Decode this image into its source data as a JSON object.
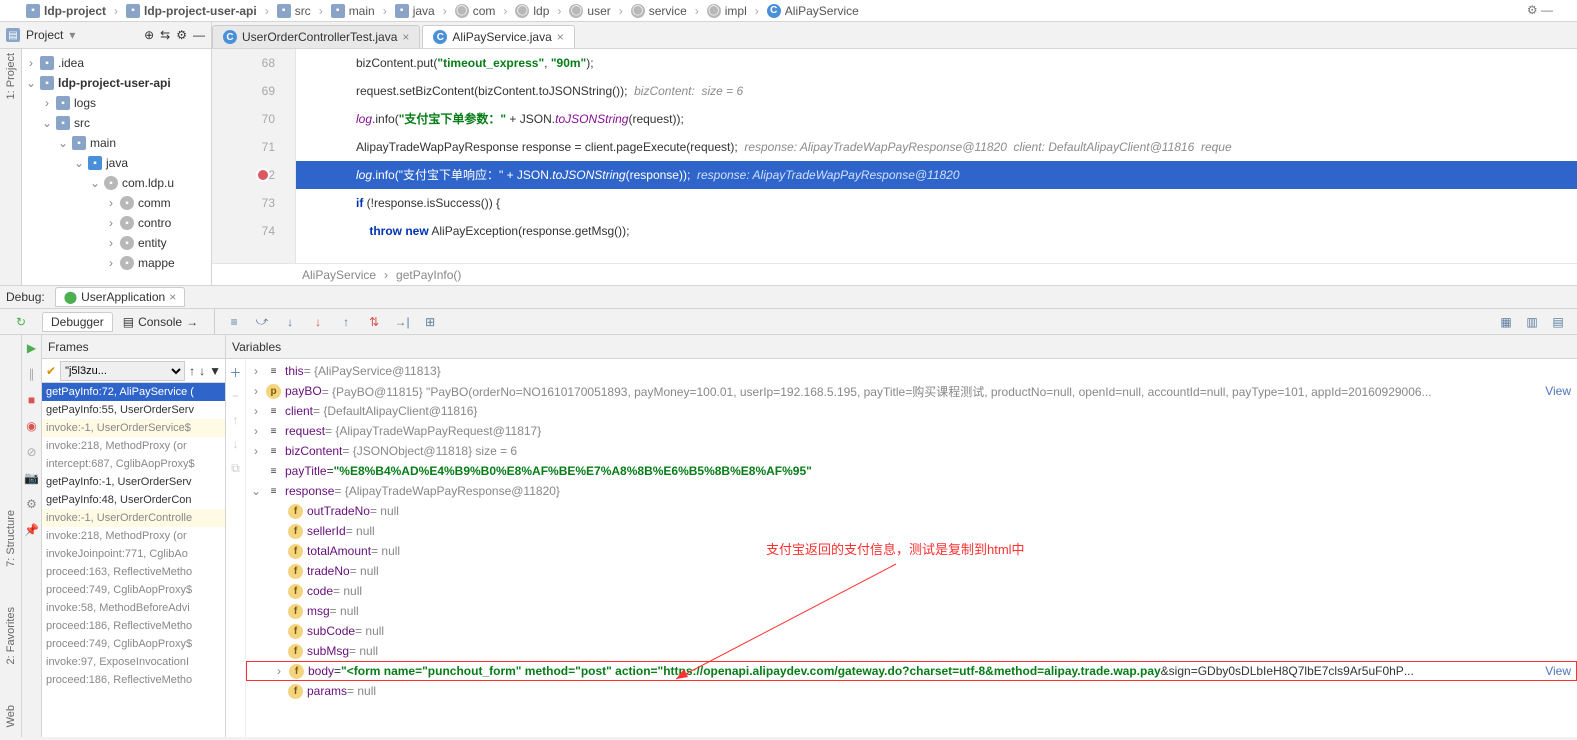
{
  "breadcrumb": [
    "ldp-project",
    "ldp-project-user-api",
    "src",
    "main",
    "java",
    "com",
    "ldp",
    "user",
    "service",
    "impl",
    "AliPayService"
  ],
  "breadcrumb_icons": [
    "folder",
    "folder",
    "folder",
    "folder",
    "folder",
    "package",
    "package",
    "package",
    "package",
    "package",
    "class"
  ],
  "proj_label": "Project",
  "tabs": [
    {
      "label": "UserOrderControllerTest.java",
      "active": false
    },
    {
      "label": "AliPayService.java",
      "active": true
    }
  ],
  "sidetabs": {
    "project": "1: Project",
    "structure": "7: Structure",
    "favorites": "2: Favorites",
    "web": "Web"
  },
  "tree": [
    {
      "ind": 0,
      "tw": "›",
      "ic": "folder",
      "label": ".idea"
    },
    {
      "ind": 0,
      "tw": "⌄",
      "ic": "folder",
      "label": "ldp-project-user-api",
      "bold": true
    },
    {
      "ind": 1,
      "tw": "›",
      "ic": "folder",
      "label": "logs"
    },
    {
      "ind": 1,
      "tw": "⌄",
      "ic": "folder",
      "label": "src"
    },
    {
      "ind": 2,
      "tw": "⌄",
      "ic": "folder",
      "label": "main"
    },
    {
      "ind": 3,
      "tw": "⌄",
      "ic": "folder",
      "label": "java",
      "blue": true
    },
    {
      "ind": 4,
      "tw": "⌄",
      "ic": "package",
      "label": "com.ldp.u"
    },
    {
      "ind": 5,
      "tw": "›",
      "ic": "package",
      "label": "comm"
    },
    {
      "ind": 5,
      "tw": "›",
      "ic": "package",
      "label": "contro"
    },
    {
      "ind": 5,
      "tw": "›",
      "ic": "package",
      "label": "entity"
    },
    {
      "ind": 5,
      "tw": "›",
      "ic": "package",
      "label": "mappe"
    }
  ],
  "code": [
    {
      "n": "68",
      "html": "bizContent.put(<span class='str'>\"timeout_express\"</span>, <span class='str'>\"90m\"</span>);"
    },
    {
      "n": "69",
      "html": "request.setBizContent(bizContent.toJSONString());  <span class='cmt'>bizContent:  size = 6</span>"
    },
    {
      "n": "70",
      "html": "<span class='stat'>log</span>.info(<span class='str'>\"支付宝下单参数：\"</span> + JSON.<span class='stat'>toJSONString</span>(request));"
    },
    {
      "n": "71",
      "html": "AlipayTradeWapPayResponse response = client.pageExecute(request);  <span class='cmt'>response: AlipayTradeWapPayResponse@11820  client: DefaultAlipayClient@11816  reque</span>"
    },
    {
      "n": "72",
      "hl": true,
      "bp": true,
      "html": "<span style='font-style:italic'>log</span>.info(<span>\"支付宝下单响应：\"</span> + JSON.<span style='font-style:italic'>toJSONString</span>(response));  <span style='font-style:italic;color:#cfe0ff'>response: AlipayTradeWapPayResponse@11820</span>"
    },
    {
      "n": "73",
      "html": "<span class='kw'>if</span> (!response.isSuccess()) {"
    },
    {
      "n": "74",
      "html": "    <span class='kw'>throw new</span> AliPayException(response.getMsg());"
    },
    {
      "n": "",
      "html": ""
    }
  ],
  "ed_crumb": [
    "AliPayService",
    "getPayInfo()"
  ],
  "debug_label": "Debug:",
  "debug_tab": "UserApplication",
  "debugger_tab": "Debugger",
  "console_tab": "Console",
  "frames_label": "Frames",
  "thread": "\"j5l3zu...",
  "frames": [
    {
      "t": "getPayInfo:72, AliPayService (",
      "sel": true
    },
    {
      "t": "getPayInfo:55, UserOrderServ"
    },
    {
      "t": "invoke:-1, UserOrderService$",
      "yel": true
    },
    {
      "t": "invoke:218, MethodProxy (or",
      "dim": true
    },
    {
      "t": "intercept:687, CglibAopProxy$",
      "dim": true
    },
    {
      "t": "getPayInfo:-1, UserOrderServ"
    },
    {
      "t": "getPayInfo:48, UserOrderCon"
    },
    {
      "t": "invoke:-1, UserOrderControlle",
      "yel": true
    },
    {
      "t": "invoke:218, MethodProxy (or",
      "dim": true
    },
    {
      "t": "invokeJoinpoint:771, CglibAo",
      "dim": true
    },
    {
      "t": "proceed:163, ReflectiveMetho",
      "dim": true
    },
    {
      "t": "proceed:749, CglibAopProxy$",
      "dim": true
    },
    {
      "t": "invoke:58, MethodBeforeAdvi",
      "dim": true
    },
    {
      "t": "proceed:186, ReflectiveMetho",
      "dim": true
    },
    {
      "t": "proceed:749, CglibAopProxy$",
      "dim": true
    },
    {
      "t": "invoke:97, ExposeInvocationI",
      "dim": true
    },
    {
      "t": "proceed:186, ReflectiveMetho",
      "dim": true
    }
  ],
  "variables_label": "Variables",
  "vars": [
    {
      "ind": 0,
      "tw": "›",
      "b": "eq",
      "name": "this",
      "val": " = {AliPayService@11813}"
    },
    {
      "ind": 0,
      "tw": "›",
      "b": "p",
      "name": "payBO",
      "val": " = {PayBO@11815} \"PayBO(orderNo=NO1610170051893, payMoney=100.01, userIp=192.168.5.195, payTitle=购买课程测试, productNo=null, openId=null, accountId=null, payType=101, appId=20160929006...",
      "view": true
    },
    {
      "ind": 0,
      "tw": "›",
      "b": "eq",
      "name": "client",
      "val": " = {DefaultAlipayClient@11816}"
    },
    {
      "ind": 0,
      "tw": "›",
      "b": "eq",
      "name": "request",
      "val": " = {AlipayTradeWapPayRequest@11817}"
    },
    {
      "ind": 0,
      "tw": "›",
      "b": "eq",
      "name": "bizContent",
      "val": " = {JSONObject@11818}  size = 6"
    },
    {
      "ind": 0,
      "tw": "",
      "b": "eq",
      "name": "payTitle",
      "str": "\"%E8%B4%AD%E4%B9%B0%E8%AF%BE%E7%A8%8B%E6%B5%8B%E8%AF%95\""
    },
    {
      "ind": 0,
      "tw": "⌄",
      "b": "eq",
      "name": "response",
      "val": " = {AlipayTradeWapPayResponse@11820}"
    },
    {
      "ind": 1,
      "tw": "",
      "b": "f",
      "name": "outTradeNo",
      "val": " = null"
    },
    {
      "ind": 1,
      "tw": "",
      "b": "f",
      "name": "sellerId",
      "val": " = null"
    },
    {
      "ind": 1,
      "tw": "",
      "b": "f",
      "name": "totalAmount",
      "val": " = null"
    },
    {
      "ind": 1,
      "tw": "",
      "b": "f",
      "name": "tradeNo",
      "val": " = null"
    },
    {
      "ind": 1,
      "tw": "",
      "b": "f",
      "name": "code",
      "val": " = null"
    },
    {
      "ind": 1,
      "tw": "",
      "b": "f",
      "name": "msg",
      "val": " = null"
    },
    {
      "ind": 1,
      "tw": "",
      "b": "f",
      "name": "subCode",
      "val": " = null"
    },
    {
      "ind": 1,
      "tw": "",
      "b": "f",
      "name": "subMsg",
      "val": " = null"
    },
    {
      "ind": 1,
      "tw": "›",
      "b": "f",
      "name": "body",
      "red": true,
      "view": true,
      "html": " = <span class='vstr'>\"&lt;form name=\"punchout_form\" method=\"post\" action=\"https://openapi.alipaydev.com/gateway.do?charset=utf-8&amp;method=alipay.trade.wap.pay</span><span style='color:#333'>&amp;sign=GDby0sDLbIeH8Q7lbE7cls9Ar5uF0hP</span>..."
    },
    {
      "ind": 1,
      "tw": "",
      "b": "f",
      "name": "params",
      "val": " = null"
    }
  ],
  "annotation": "支付宝返回的支付信息，测试是复制到html中"
}
